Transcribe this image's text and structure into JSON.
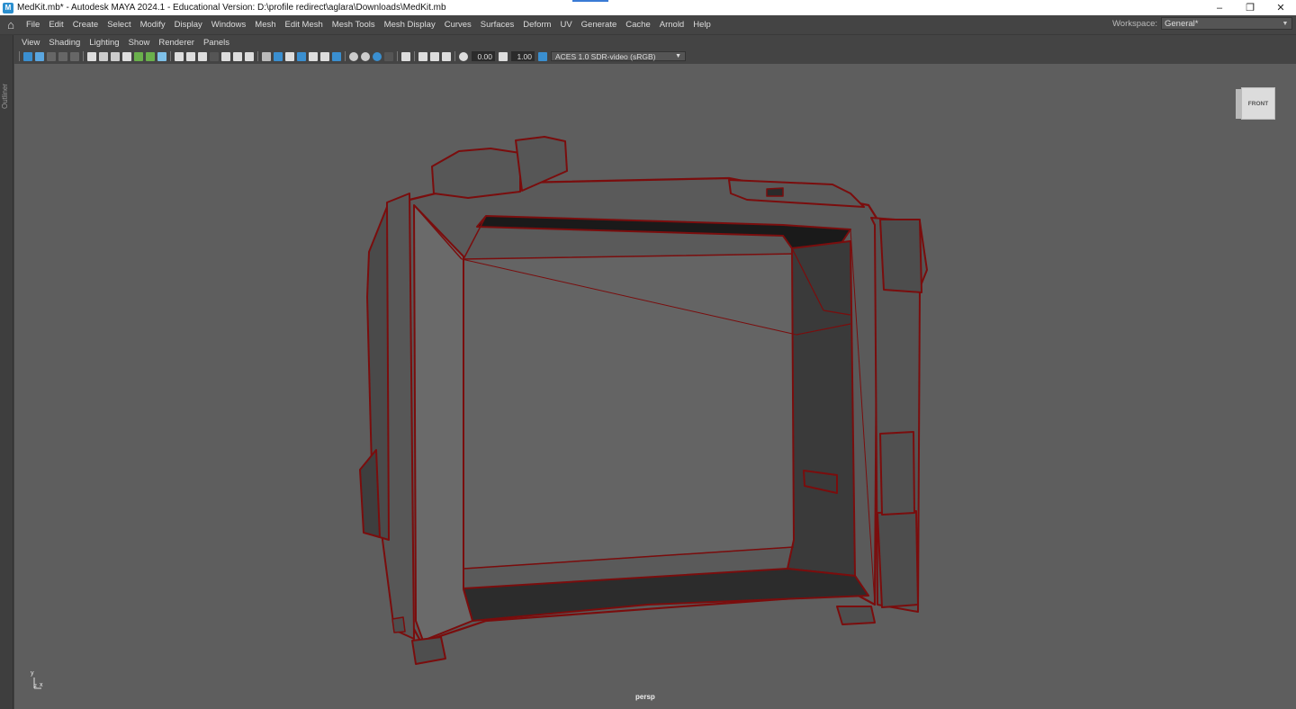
{
  "window": {
    "title": "MedKit.mb* - Autodesk MAYA 2024.1 - Educational Version: D:\\profile redirect\\aglara\\Downloads\\MedKit.mb",
    "minimize_glyph": "–",
    "restore_glyph": "❐",
    "close_glyph": "✕"
  },
  "menubar": {
    "items": [
      "File",
      "Edit",
      "Create",
      "Select",
      "Modify",
      "Display",
      "Windows",
      "Mesh",
      "Edit Mesh",
      "Mesh Tools",
      "Mesh Display",
      "Curves",
      "Surfaces",
      "Deform",
      "UV",
      "Generate",
      "Cache",
      "Arnold",
      "Help"
    ],
    "workspace_label": "Workspace:",
    "workspace_value": "General*"
  },
  "outliner": {
    "label": "Outliner"
  },
  "panel_menu": {
    "items": [
      "View",
      "Shading",
      "Lighting",
      "Show",
      "Renderer",
      "Panels"
    ]
  },
  "toolbar": {
    "exposure_value": "0.00",
    "gamma_value": "1.00",
    "color_space": "ACES 1.0 SDR-video (sRGB)"
  },
  "viewport": {
    "camera": "persp",
    "viewcube_face": "FRONT",
    "axis_y": "y",
    "axis_x": "x",
    "axis_z": "z",
    "wire_color": "#7a0d0d",
    "background_color": "#5e5e5e"
  }
}
